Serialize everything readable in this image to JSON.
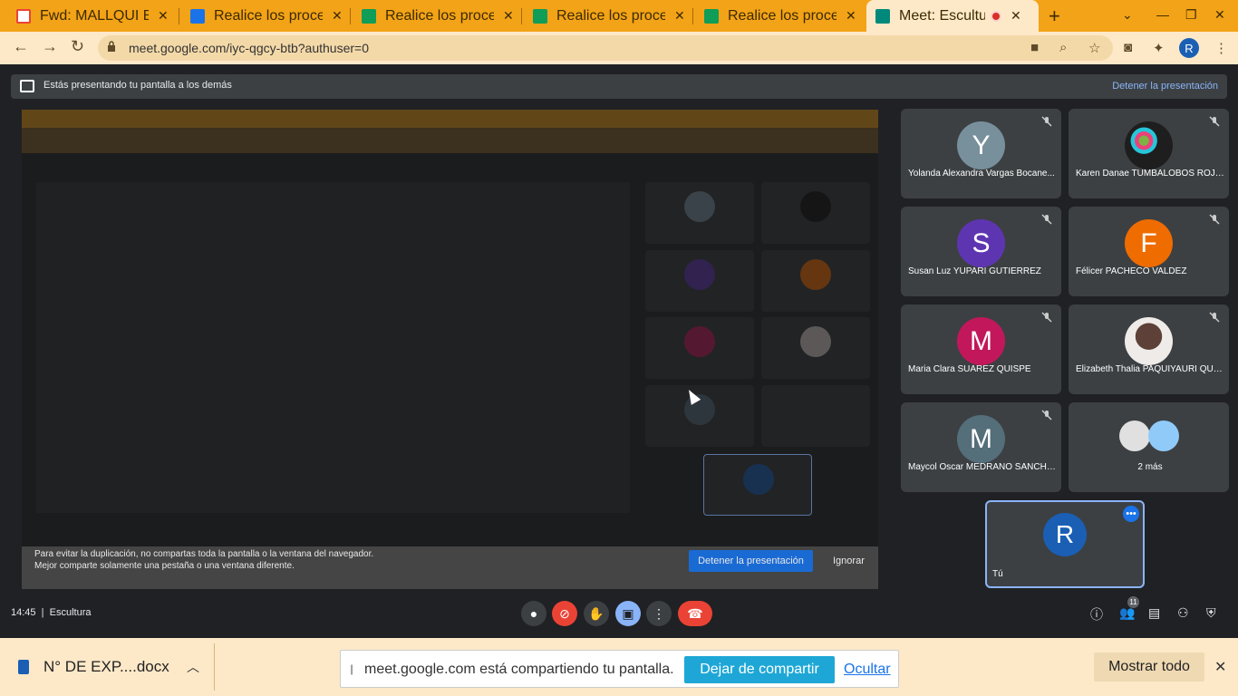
{
  "browser": {
    "tabs": [
      {
        "label": "Fwd: MALLQUI BA",
        "icon": "gmail-icon",
        "color": "#ea4335"
      },
      {
        "label": "Realice los proces",
        "icon": "docs-blue-icon",
        "color": "#1a73e8"
      },
      {
        "label": "Realice los proces",
        "icon": "classroom-icon",
        "color": "#0f9d58"
      },
      {
        "label": "Realice los proces",
        "icon": "classroom-icon",
        "color": "#0f9d58"
      },
      {
        "label": "Realice los proces",
        "icon": "classroom-icon",
        "color": "#0f9d58"
      },
      {
        "label": "Meet: Escultur",
        "icon": "meet-icon",
        "color": "#00897b"
      }
    ],
    "url": "meet.google.com/iyc-qgcy-btb?authuser=0",
    "profile_initial": "R"
  },
  "presenting": {
    "message": "Estás presentando tu pantalla a los demás",
    "stop_link": "Detener la presentación"
  },
  "screenshare_footer": {
    "message_line1": "Para evitar la duplicación, no compartas toda la pantalla o la ventana del navegador.",
    "message_line2": "Mejor comparte solamente una pestaña o una ventana diferente.",
    "stop_button": "Detener la presentación",
    "ignore": "Ignorar"
  },
  "participants": [
    {
      "name": "Yolanda Alexandra Vargas Bocane...",
      "initial": "Y",
      "color": "#78909c"
    },
    {
      "name": "Karen Danae TUMBALOBOS ROJAS",
      "initial": "",
      "color": "#1e1e1e"
    },
    {
      "name": "Susan Luz YUPARI GUTIERREZ",
      "initial": "S",
      "color": "#5e35b1"
    },
    {
      "name": "Félicer PACHECO VALDEZ",
      "initial": "F",
      "color": "#ef6c00"
    },
    {
      "name": "Maria Clara SUAREZ QUISPE",
      "initial": "M",
      "color": "#c2185b"
    },
    {
      "name": "Elizabeth Thalia PAQUIYAURI QUIS...",
      "initial": "",
      "color": "#d7ccc8"
    },
    {
      "name": "Maycol Oscar MEDRANO SANCHEZ",
      "initial": "M",
      "color": "#546e7a"
    }
  ],
  "more_tile": {
    "label": "2 más"
  },
  "self_tile": {
    "name": "Tú",
    "initial": "R"
  },
  "controls": {
    "time": "14:45",
    "meeting_name": "Escultura",
    "participant_count": "11"
  },
  "download_bar": {
    "file_name": "N° DE EXP....docx",
    "share_message": "meet.google.com está compartiendo tu pantalla.",
    "stop_share": "Dejar de compartir",
    "hide": "Ocultar",
    "show_all": "Mostrar todo"
  }
}
